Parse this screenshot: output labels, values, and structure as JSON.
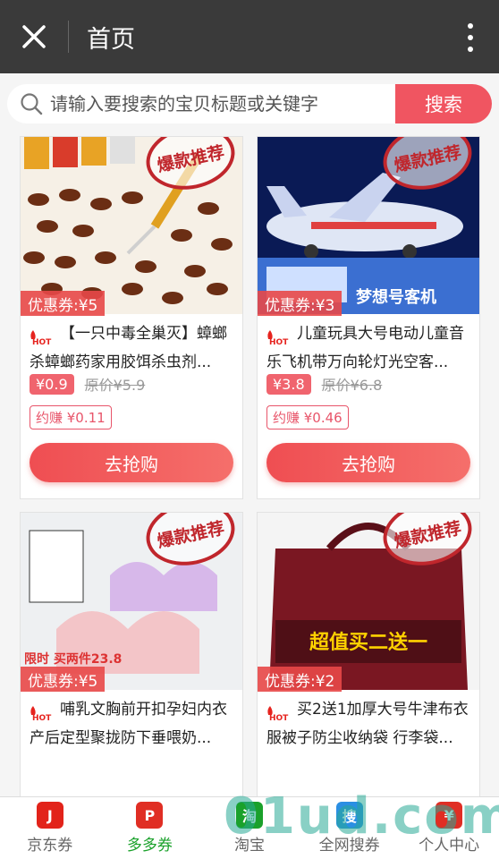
{
  "header": {
    "title": "首页"
  },
  "search": {
    "placeholder": "请输入要搜索的宝贝标题或关键字",
    "button_label": "搜索"
  },
  "stamp_text": "爆款推荐",
  "products": [
    {
      "coupon": "优惠券:¥5",
      "name": "【一只中毒全巢灭】蟑螂杀蟑螂药家用胶饵杀虫剂...",
      "price": "¥0.9",
      "original_price": "原价¥5.9",
      "earn": "约赚 ¥0.11",
      "buy_label": "去抢购"
    },
    {
      "coupon": "优惠券:¥3",
      "name": "儿童玩具大号电动儿童音乐飞机带万向轮灯光空客...",
      "price": "¥3.8",
      "original_price": "原价¥6.8",
      "earn": "约赚 ¥0.46",
      "buy_label": "去抢购",
      "image_caption": "梦想号客机"
    },
    {
      "coupon": "优惠券:¥5",
      "name": "哺乳文胸前开扣孕妇内衣产后定型聚拢防下垂喂奶...",
      "image_caption": "限时 买两件23.8"
    },
    {
      "coupon": "优惠券:¥2",
      "name": "买2送1加厚大号牛津布衣服被子防尘收纳袋 行李袋...",
      "image_caption": "超值买二送一"
    }
  ],
  "tabs": [
    {
      "label": "京东券",
      "icon": "jd-icon",
      "color": "#e2231a"
    },
    {
      "label": "多多券",
      "icon": "pdd-icon",
      "color": "#e02e24"
    },
    {
      "label": "淘宝",
      "icon": "taobao-icon",
      "color": "#1aa12b"
    },
    {
      "label": "全网搜券",
      "icon": "search-all-icon",
      "color": "#2b8fe3"
    },
    {
      "label": "个人中心",
      "icon": "user-center-icon",
      "color": "#e02e24"
    }
  ],
  "watermark": "01ud.com"
}
